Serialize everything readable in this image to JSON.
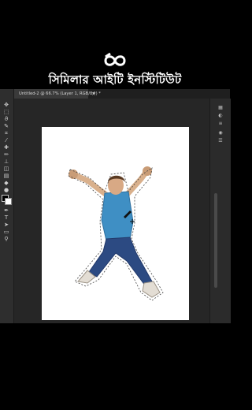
{
  "brand": {
    "text": "সিমিলার আইটি ইনস্টিটিউট",
    "logo": "infinity-logo"
  },
  "document_tab": {
    "title": "Untitled-2 @ 66.7% (Layer 1, RGB/8#) *",
    "close": "×"
  },
  "tools": [
    {
      "name": "move-tool-icon",
      "glyph": "✥"
    },
    {
      "name": "marquee-tool-icon",
      "glyph": "⬚"
    },
    {
      "name": "lasso-tool-icon",
      "glyph": "ϑ"
    },
    {
      "name": "quick-select-tool-icon",
      "glyph": "✎"
    },
    {
      "name": "crop-tool-icon",
      "glyph": "⌗"
    },
    {
      "name": "eyedropper-tool-icon",
      "glyph": "⁄"
    },
    {
      "name": "healing-tool-icon",
      "glyph": "✚"
    },
    {
      "name": "brush-tool-icon",
      "glyph": "✏"
    },
    {
      "name": "stamp-tool-icon",
      "glyph": "⊥"
    },
    {
      "name": "eraser-tool-icon",
      "glyph": "◫"
    },
    {
      "name": "gradient-tool-icon",
      "glyph": "▤"
    },
    {
      "name": "blur-tool-icon",
      "glyph": "◆"
    },
    {
      "name": "dodge-tool-icon",
      "glyph": "●"
    },
    {
      "name": "pen-tool-icon",
      "glyph": "✒"
    },
    {
      "name": "type-tool-icon",
      "glyph": "T"
    },
    {
      "name": "path-select-tool-icon",
      "glyph": "➤"
    },
    {
      "name": "shape-tool-icon",
      "glyph": "▭"
    },
    {
      "name": "zoom-tool-icon",
      "glyph": "⚲"
    }
  ],
  "right_tools": [
    {
      "name": "history-panel-icon",
      "glyph": "▦"
    },
    {
      "name": "adjust-panel-icon",
      "glyph": "◐"
    },
    {
      "name": "layers-panel-icon",
      "glyph": "≡"
    },
    {
      "name": "color-panel-icon",
      "glyph": "◉"
    },
    {
      "name": "properties-panel-icon",
      "glyph": "☰"
    }
  ],
  "colors": {
    "accent": "#ffffff",
    "shirt": "#3f8fc4",
    "jeans": "#2c4a82",
    "hair": "#5a3a22"
  }
}
